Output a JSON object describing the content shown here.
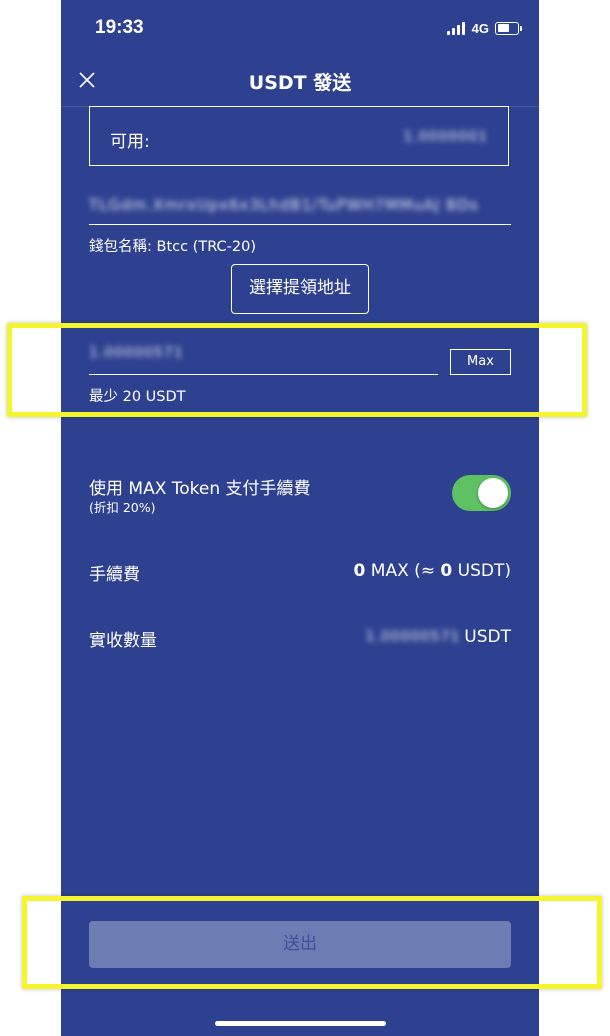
{
  "status_bar": {
    "time": "19:33",
    "network": "4G",
    "icons": [
      "signal-bars-icon",
      "battery-icon"
    ]
  },
  "nav": {
    "title": "USDT 發送",
    "close_icon": "close-icon"
  },
  "available": {
    "label": "可用:",
    "value": "1.0000001"
  },
  "address": {
    "value": "TLGdm.XmrxUpx6x3LhdB1/TuPWH7MMuAJ BDs",
    "wallet_name": "錢包名稱: Btcc (TRC-20)",
    "select_button": "選擇提領地址"
  },
  "amount": {
    "value": "1.00000571",
    "max_button": "Max",
    "minimum": "最少 20 USDT"
  },
  "max_token": {
    "label": "使用 MAX Token 支付手續費",
    "discount": "(折扣 20%)",
    "enabled": true
  },
  "fee": {
    "label": "手續費",
    "max_amount": "0",
    "max_unit": " MAX (≈ ",
    "usdt_amount": "0",
    "usdt_unit": " USDT)"
  },
  "received": {
    "label": "實收數量",
    "value": "1.00000571",
    "unit": "USDT"
  },
  "submit": {
    "label": "送出"
  },
  "colors": {
    "background": "#2e4190",
    "toggle_on": "#5ec263",
    "button_disabled": "#6d7db4",
    "highlight": "#f5f52d"
  }
}
